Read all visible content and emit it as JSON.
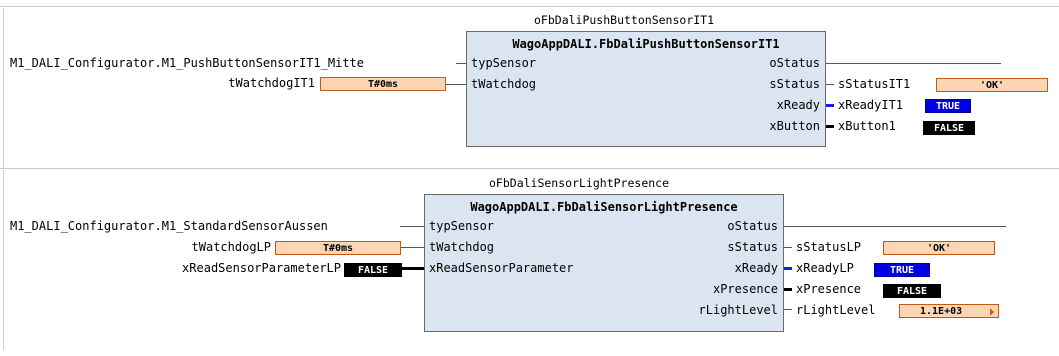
{
  "networks": [
    {
      "instance": "oFbDaliPushButtonSensorIT1",
      "block": {
        "type": "WagoAppDALI.FbDaliPushButtonSensorIT1",
        "inputs": [
          "typSensor",
          "tWatchdog"
        ],
        "outputs": [
          "oStatus",
          "sStatus",
          "xReady",
          "xButton"
        ]
      },
      "in_vars": {
        "typSensor": "M1_DALI_Configurator.M1_PushButtonSensorIT1_Mitte",
        "tWatchdog": "tWatchdogIT1"
      },
      "in_values": {
        "tWatchdog": "T#0ms"
      },
      "out_vars": {
        "sStatus": "sStatusIT1",
        "xReady": "xReadyIT1",
        "xButton": "xButton1"
      },
      "out_values": {
        "sStatus": "'OK'",
        "xReady": "TRUE",
        "xButton": "FALSE"
      }
    },
    {
      "instance": "oFbDaliSensorLightPresence",
      "block": {
        "type": "WagoAppDALI.FbDaliSensorLightPresence",
        "inputs": [
          "typSensor",
          "tWatchdog",
          "xReadSensorParameter"
        ],
        "outputs": [
          "oStatus",
          "sStatus",
          "xReady",
          "xPresence",
          "rLightLevel"
        ]
      },
      "in_vars": {
        "typSensor": "M1_DALI_Configurator.M1_StandardSensorAussen",
        "tWatchdog": "tWatchdogLP",
        "xReadSensorParameter": "xReadSensorParameterLP"
      },
      "in_values": {
        "tWatchdog": "T#0ms",
        "xReadSensorParameter": "FALSE"
      },
      "out_vars": {
        "sStatus": "sStatusLP",
        "xReady": "xReadyLP",
        "xPresence": "xPresence",
        "rLightLevel": "rLightLevel"
      },
      "out_values": {
        "sStatus": "'OK'",
        "xReady": "TRUE",
        "xPresence": "FALSE",
        "rLightLevel": "1.1E+03"
      }
    }
  ],
  "colors": {
    "block_fill": "#dbe5f1",
    "monitor_orange": "#fcd5b4",
    "true_blue": "#0000e0",
    "false_black": "#000000"
  }
}
